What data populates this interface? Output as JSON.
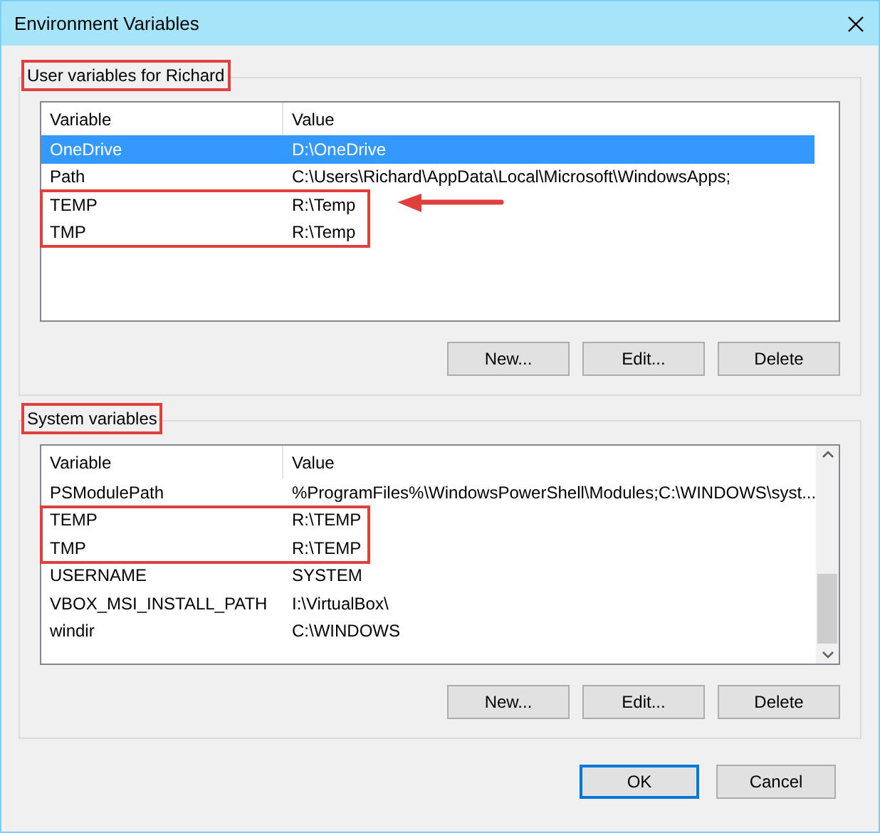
{
  "window": {
    "title": "Environment Variables"
  },
  "user_variables": {
    "label": "User variables for Richard",
    "highlighted": true,
    "arrow": true,
    "columns": [
      "Variable",
      "Value"
    ],
    "rows": [
      {
        "variable": "OneDrive",
        "value": "D:\\OneDrive",
        "selected": true,
        "highlighted": false
      },
      {
        "variable": "Path",
        "value": "C:\\Users\\Richard\\AppData\\Local\\Microsoft\\WindowsApps;",
        "selected": false,
        "highlighted": false
      },
      {
        "variable": "TEMP",
        "value": "R:\\Temp",
        "selected": false,
        "highlighted": true
      },
      {
        "variable": "TMP",
        "value": "R:\\Temp",
        "selected": false,
        "highlighted": true
      }
    ],
    "buttons": [
      "New...",
      "Edit...",
      "Delete"
    ]
  },
  "system_variables": {
    "label": "System variables",
    "highlighted": true,
    "columns": [
      "Variable",
      "Value"
    ],
    "rows": [
      {
        "variable": "PSModulePath",
        "value": "%ProgramFiles%\\WindowsPowerShell\\Modules;C:\\WINDOWS\\syst...",
        "selected": false,
        "highlighted": false
      },
      {
        "variable": "TEMP",
        "value": "R:\\TEMP",
        "selected": false,
        "highlighted": true
      },
      {
        "variable": "TMP",
        "value": "R:\\TEMP",
        "selected": false,
        "highlighted": true
      },
      {
        "variable": "USERNAME",
        "value": "SYSTEM",
        "selected": false,
        "highlighted": false
      },
      {
        "variable": "VBOX_MSI_INSTALL_PATH",
        "value": "I:\\VirtualBox\\",
        "selected": false,
        "highlighted": false
      },
      {
        "variable": "windir",
        "value": "C:\\WINDOWS",
        "selected": false,
        "highlighted": false
      }
    ],
    "buttons": [
      "New...",
      "Edit...",
      "Delete"
    ]
  },
  "dialog_buttons": [
    {
      "label": "OK",
      "default": true
    },
    {
      "label": "Cancel",
      "default": false
    }
  ]
}
